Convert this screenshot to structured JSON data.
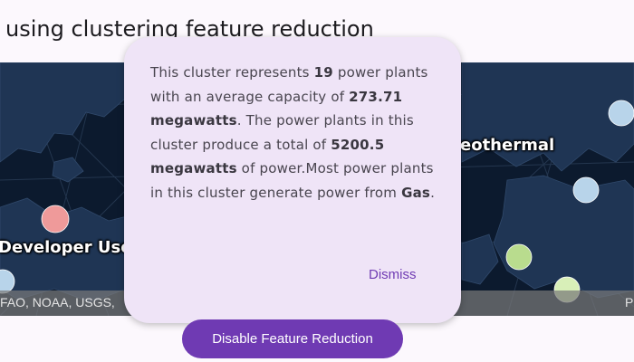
{
  "header": {
    "title": "using clustering feature reduction"
  },
  "map": {
    "labels": {
      "left": "Developer Use",
      "right": "eothermal"
    },
    "attribution": {
      "text": "FAO, NOAA, USGS,",
      "right_fragment": "P"
    },
    "cluster_colors": {
      "pink": "#ef9a9a",
      "light_blue": "#b8d4ea",
      "green": "#b9dc8e",
      "pale_green": "#d8efb8"
    }
  },
  "dialog": {
    "t1": "This cluster represents ",
    "count": "19",
    "t2": " power plants with an average capacity of ",
    "avg_capacity": "273.71 megawatts",
    "t3": ". The power plants in this cluster produce a total of ",
    "total_capacity": "5200.5 megawatts",
    "t4": " of power.Most power plants in this cluster generate power from ",
    "fuel": "Gas",
    "t5": ".",
    "dismiss_label": "Dismiss"
  },
  "footer": {
    "toggle_button_label": "Disable Feature Reduction"
  },
  "colors": {
    "accent": "#6f3ab3",
    "dialog_bg": "#efe4f7",
    "map_bg": "#0c1a2e"
  }
}
